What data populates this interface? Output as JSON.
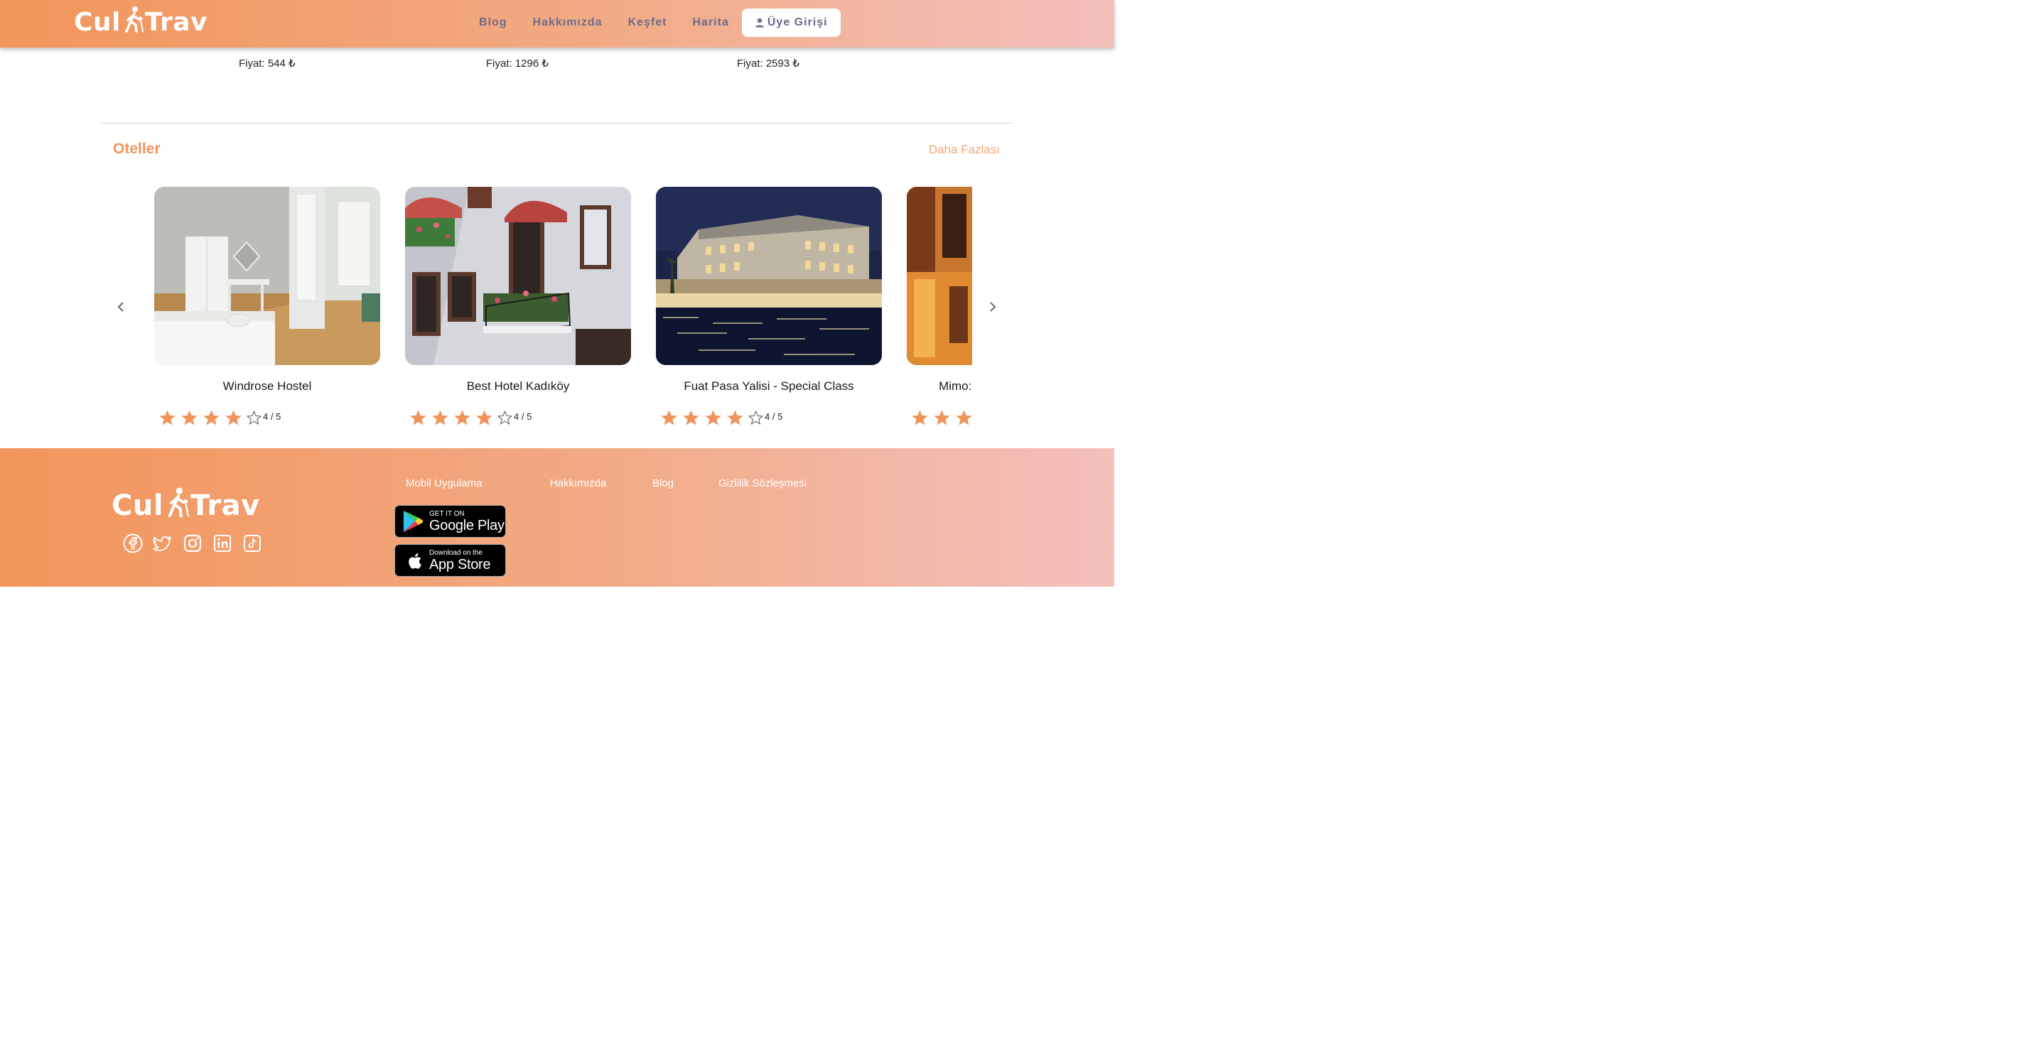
{
  "header": {
    "logo_left": "Cul",
    "logo_right": "Trav",
    "nav": [
      "Blog",
      "Hakkımızda",
      "Keşfet",
      "Harita"
    ],
    "login_label": "Üye Girişi"
  },
  "prices": [
    "Fiyat: 544 ₺",
    "Fiyat: 1296 ₺",
    "Fiyat: 2593 ₺"
  ],
  "hotels_section": {
    "title": "Oteller",
    "more_label": "Daha Fazlası",
    "cards": [
      {
        "name": "Windrose Hostel",
        "rating_text": "4 / 5",
        "rating": 4
      },
      {
        "name": "Best Hotel Kadıköy",
        "rating_text": "4 / 5",
        "rating": 4
      },
      {
        "name": "Fuat Pasa Yalisi - Special Class",
        "rating_text": "4 / 5",
        "rating": 4
      },
      {
        "name": "Mimo:",
        "rating_text": "",
        "rating": 3
      }
    ]
  },
  "footer": {
    "logo_left": "Cul",
    "logo_right": "Trav",
    "links": [
      "Mobil Uygulama",
      "Hakkımızda",
      "Blog",
      "Gizlilik Sözleşmesi"
    ],
    "google_play": {
      "small": "GET IT ON",
      "big": "Google Play"
    },
    "app_store": {
      "small": "Download on the",
      "big": "App Store"
    },
    "socials": [
      "facebook-icon",
      "twitter-icon",
      "instagram-icon",
      "linkedin-icon",
      "tiktok-icon"
    ]
  },
  "colors": {
    "accent": "#f2955b",
    "gradient_end": "#f3c0bd",
    "nav_text": "#6e6a8a",
    "star": "#f0935a"
  }
}
